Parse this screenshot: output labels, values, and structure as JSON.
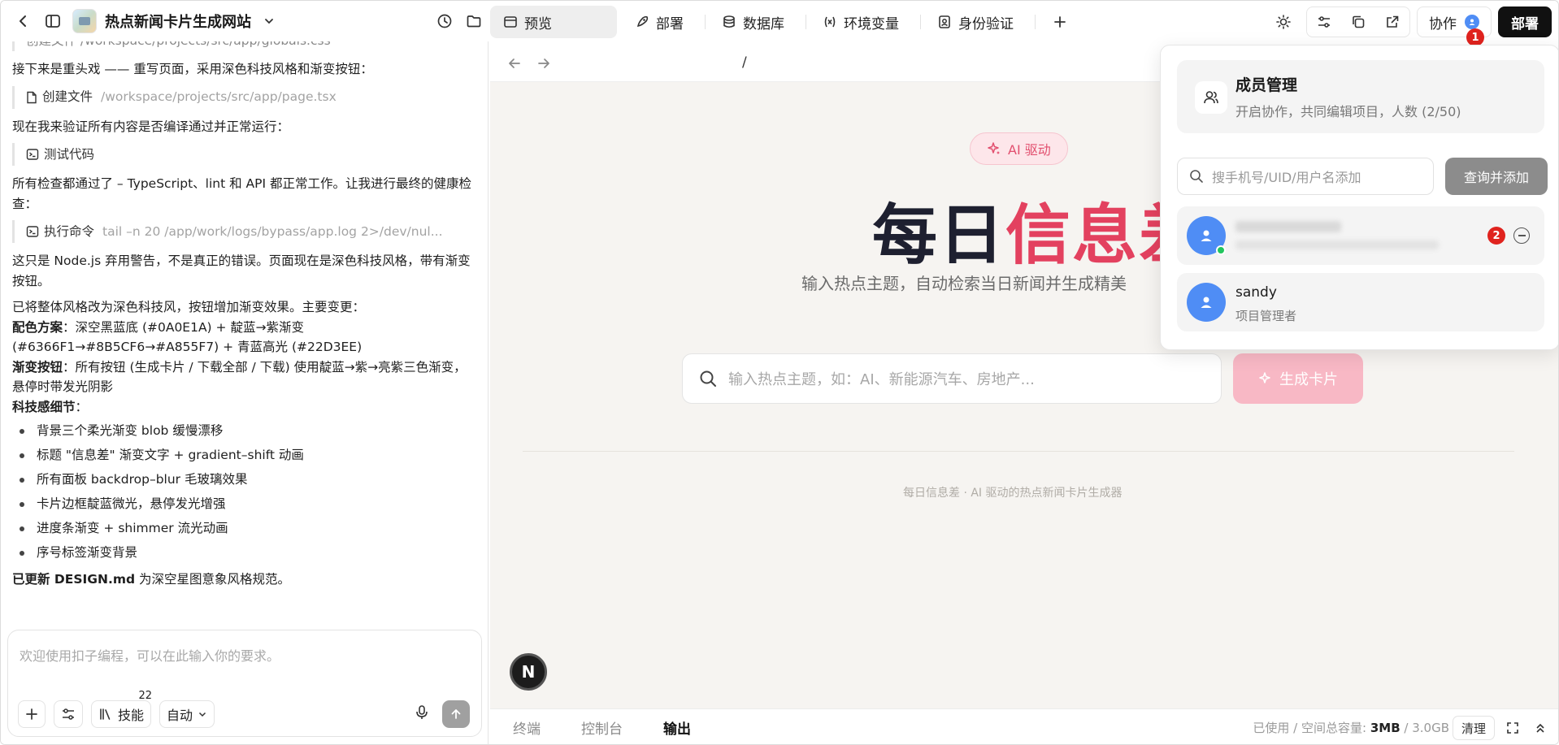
{
  "app": {
    "name": "热点新闻卡片生成网站"
  },
  "tabs": [
    {
      "label": "预览"
    },
    {
      "label": "部署"
    },
    {
      "label": "数据库"
    },
    {
      "label": "环境变量"
    },
    {
      "label": "身份验证"
    }
  ],
  "header": {
    "collab_label": "协作",
    "collab_badge": "1",
    "deploy_label": "部署"
  },
  "chat": {
    "top_partial": "创建文件 /workspace/projects/src/app/globals.css",
    "msg1": "接下来是重头戏 —— 重写页面，采用深色科技风格和渐变按钮：",
    "tool1_label": "创建文件",
    "tool1_path": "/workspace/projects/src/app/page.tsx",
    "msg2": "现在我来验证所有内容是否编译通过并正常运行：",
    "tool2_label": "测试代码",
    "msg3": "所有检查都通过了 – TypeScript、lint 和 API 都正常工作。让我进行最终的健康检查：",
    "tool3_label": "执行命令",
    "tool3_cmd": "tail –n 20 /app/work/logs/bypass/app.log 2>/dev/nul...",
    "msg4": "这只是 Node.js 弃用警告，不是真正的错误。页面现在是深色科技风格，带有渐变按钮。",
    "msg5": "已将整体风格改为深色科技风，按钮增加渐变效果。主要变更：",
    "color_label": "配色方案",
    "color_text": "：深空黑蓝底 (#0A0E1A) + 靛蓝→紫渐变 (#6366F1→#8B5CF6→#A855F7) + 青蓝高光 (#22D3EE)",
    "grad_label": "渐变按钮",
    "grad_text": "：所有按钮 (生成卡片 / 下载全部 / 下载) 使用靛蓝→紫→亮紫三色渐变，悬停时带发光阴影",
    "tech_label": "科技感细节",
    "tech_colon": "：",
    "features": [
      "背景三个柔光渐变 blob 缓慢漂移",
      "标题 \"信息差\" 渐变文字 + gradient–shift 动画",
      "所有面板 backdrop–blur 毛玻璃效果",
      "卡片边框靛蓝微光，悬停发光增强",
      "进度条渐变 + shimmer 流光动画",
      "序号标签渐变背景"
    ],
    "updated_bold": "已更新 DESIGN.md",
    "updated_text": " 为深空星图意象风格规范。"
  },
  "composer": {
    "placeholder": "欢迎使用扣子编程，可以在此输入你的要求。",
    "skill_label": "技能",
    "skill_count": "22",
    "mode_label": "自动"
  },
  "preview": {
    "url": "/",
    "ai_pill": "AI 驱动",
    "hero_dark": "每日",
    "hero_pink": "信息差",
    "subtitle": "输入热点主题，自动检索当日新闻并生成精美",
    "search_placeholder": "输入热点主题，如：AI、新能源汽车、房地产...",
    "gen_button": "生成卡片",
    "footer": "每日信息差 · AI 驱动的热点新闻卡片生成器",
    "n_badge": "N"
  },
  "bottom": {
    "tabs": [
      "终端",
      "控制台",
      "输出"
    ],
    "storage_prefix": "已使用 / 空间总容量:",
    "storage_used": "3MB",
    "storage_sep": " / ",
    "storage_total": "3.0GB",
    "clear_label": "清理"
  },
  "popup": {
    "title": "成员管理",
    "subtitle": "开启协作，共同编辑项目，人数 (2/50)",
    "input_placeholder": "搜手机号/UID/用户名添加",
    "add_button": "查询并添加",
    "member2_badge": "2",
    "member_name": "sandy",
    "member_role": "项目管理者"
  },
  "colors": {
    "accent_pink": "#e3415f",
    "avatar_blue": "#4f8df5",
    "badge_red": "#e0231e",
    "online_green": "#22c55e"
  }
}
